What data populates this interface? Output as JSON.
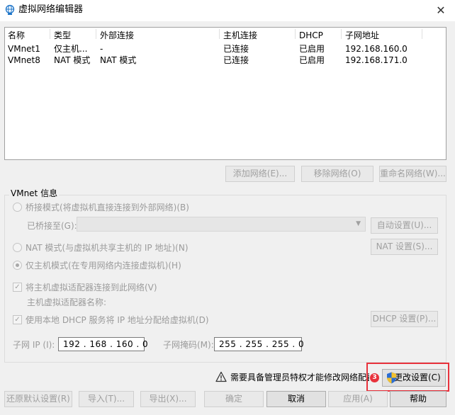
{
  "window": {
    "title": "虚拟网络编辑器",
    "close_glyph": "✕"
  },
  "network_list": {
    "headers": [
      "名称",
      "类型",
      "外部连接",
      "主机连接",
      "DHCP",
      "子网地址"
    ],
    "rows": [
      [
        "VMnet1",
        "仅主机...",
        "-",
        "已连接",
        "已启用",
        "192.168.160.0"
      ],
      [
        "VMnet8",
        "NAT 模式",
        "NAT 模式",
        "已连接",
        "已启用",
        "192.168.171.0"
      ]
    ]
  },
  "list_buttons": {
    "add": "添加网络(E)...",
    "remove": "移除网络(O)",
    "rename": "重命名网络(W)..."
  },
  "vmnet_info": {
    "title": "VMnet 信息",
    "bridged_label": "桥接模式(将虚拟机直接连接到外部网络)(B)",
    "bridged_to_label": "已桥接至(G):",
    "auto_settings": "自动设置(U)...",
    "nat_label": "NAT 模式(与虚拟机共享主机的 IP 地址)(N)",
    "nat_settings": "NAT 设置(S)...",
    "hostonly_label": "仅主机模式(在专用网络内连接虚拟机)(H)",
    "connect_adapter_label": "将主机虚拟适配器连接到此网络(V)",
    "adapter_name_label": "主机虚拟适配器名称:",
    "dhcp_label": "使用本地 DHCP 服务将 IP 地址分配给虚拟机(D)",
    "dhcp_settings": "DHCP 设置(P)...",
    "subnet_ip_label": "子网 IP (I):",
    "subnet_ip_value": "192 . 168 . 160 .  0",
    "subnet_mask_label": "子网掩码(M):",
    "subnet_mask_value": "255 . 255 . 255 .  0",
    "selected_mode": "hostonly"
  },
  "admin_notice": {
    "text": "需要具备管理员特权才能修改网络配置。",
    "change_settings": "更改设置(C)",
    "badge_number": "3",
    "highlight_color": "#e8323c"
  },
  "bottom_buttons": {
    "restore": "还原默认设置(R)",
    "import": "导入(T)...",
    "export": "导出(X)...",
    "ok": "确定",
    "cancel": "取消",
    "apply": "应用(A)",
    "help": "帮助"
  }
}
